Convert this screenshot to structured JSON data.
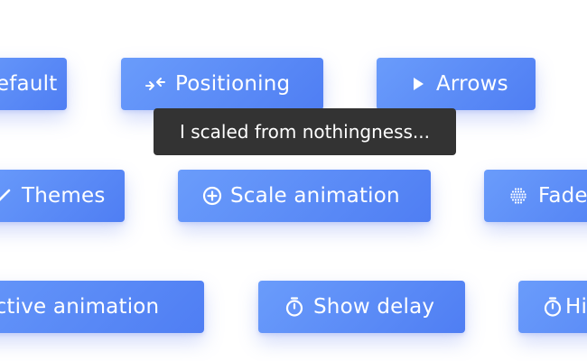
{
  "buttons": {
    "default_label": "Default",
    "positioning_label": "Positioning",
    "arrows_label": "Arrows",
    "themes_label": "Themes",
    "scale_animation_label": "Scale animation",
    "fade_label": "Fade",
    "perspective_animation_label": "Perspective animation",
    "show_delay_label": "Show delay",
    "hide_delay_label": "Hide delay"
  },
  "tooltip": {
    "text": "I scaled from nothingness..."
  },
  "colors": {
    "button_gradient_start": "#6a9cfb",
    "button_gradient_end": "#4f7ef3",
    "tooltip_background": "#333333",
    "text": "#ffffff"
  },
  "icons": {
    "positioning": "compress-arrows-icon",
    "arrows": "play-triangle-icon",
    "themes": "check-icon",
    "scale_animation": "plus-circle-icon",
    "fade": "dotted-sphere-icon",
    "show_delay": "stopwatch-icon",
    "hide_delay": "stopwatch-icon"
  }
}
